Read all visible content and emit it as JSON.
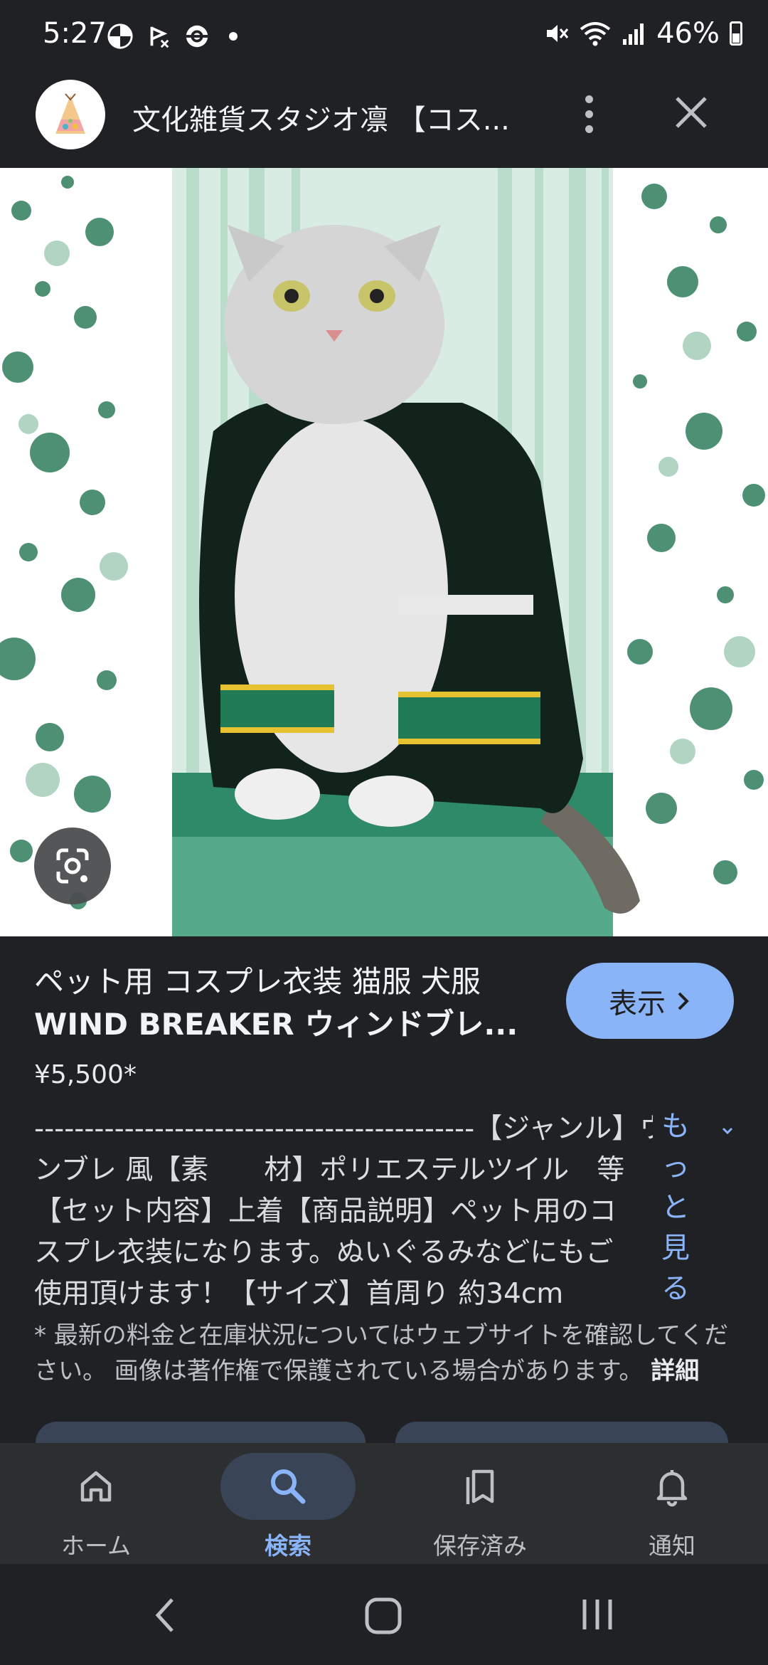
{
  "status_bar": {
    "time": "5:27",
    "battery": "46%"
  },
  "header": {
    "title": "文化雑貨スタジオ凛 【コス...",
    "icons": [
      "site-logo",
      "more-vert-icon",
      "close-icon"
    ]
  },
  "product": {
    "title_line1": "ペット用 コスプレ衣装 猫服 犬服",
    "title_line2": "WIND BREAKER ウィンドブレ...",
    "view_button": "表示",
    "price": "¥5,500*",
    "description_lines": [
      "--------------------------------------------【ジャンル】ウィ...",
      "ンブレ 風【素　　材】ポリエステルツイル　等",
      "【セット内容】上着【商品説明】ペット用のコ",
      "スプレ衣装になります。ぬいぐるみなどにもご",
      "使用頂けます！【サイズ】首周り 約34cm"
    ],
    "more_link": "もっと見る",
    "note": "* 最新の料金と在庫状況についてはウェブサイトを確認してください。 画像は著作権で保護されている場合があります。",
    "note_link": "詳細"
  },
  "bottom_nav": {
    "items": [
      {
        "label": "ホーム",
        "icon": "home-icon",
        "active": false
      },
      {
        "label": "検索",
        "icon": "search-icon",
        "active": true
      },
      {
        "label": "保存済み",
        "icon": "collections-icon",
        "active": false
      },
      {
        "label": "通知",
        "icon": "bell-icon",
        "active": false
      }
    ]
  },
  "colors": {
    "background": "#202124",
    "accent": "#8ab4f8",
    "nav_background": "#2d2e30",
    "active_pill": "#394457"
  }
}
